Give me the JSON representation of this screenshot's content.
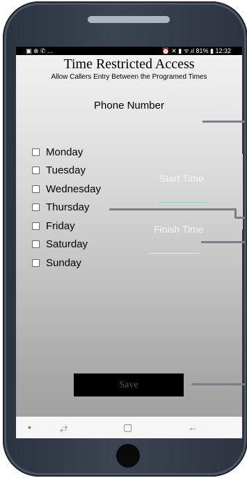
{
  "status_bar": {
    "left_icons": "▣ ⊗ ✆ ...",
    "right_icons": "⏰ ✕ ▮ ᯤ.ıl",
    "battery": "81%",
    "time": "12:32"
  },
  "header": {
    "title": "Time Restricted Access",
    "subtitle": "Allow Callers Entry Between the Programed Times"
  },
  "phone_field": {
    "label": "Phone Number",
    "value": ""
  },
  "days": [
    {
      "label": "Monday",
      "checked": false
    },
    {
      "label": "Tuesday",
      "checked": false
    },
    {
      "label": "Wednesday",
      "checked": false
    },
    {
      "label": "Thursday",
      "checked": false
    },
    {
      "label": "Friday",
      "checked": false
    },
    {
      "label": "Saturday",
      "checked": false
    },
    {
      "label": "Sunday",
      "checked": false
    }
  ],
  "time_fields": {
    "start_label": "Start Time",
    "finish_label": "Finish Time"
  },
  "save_button": {
    "label": "Save"
  },
  "nav_bar": {
    "dot": "•",
    "recent": "⥄",
    "home": "▢",
    "back": "←"
  },
  "colors": {
    "start_underline": "#8fd3cf",
    "save_background": "#000000",
    "phone_frame": "#333b46"
  }
}
